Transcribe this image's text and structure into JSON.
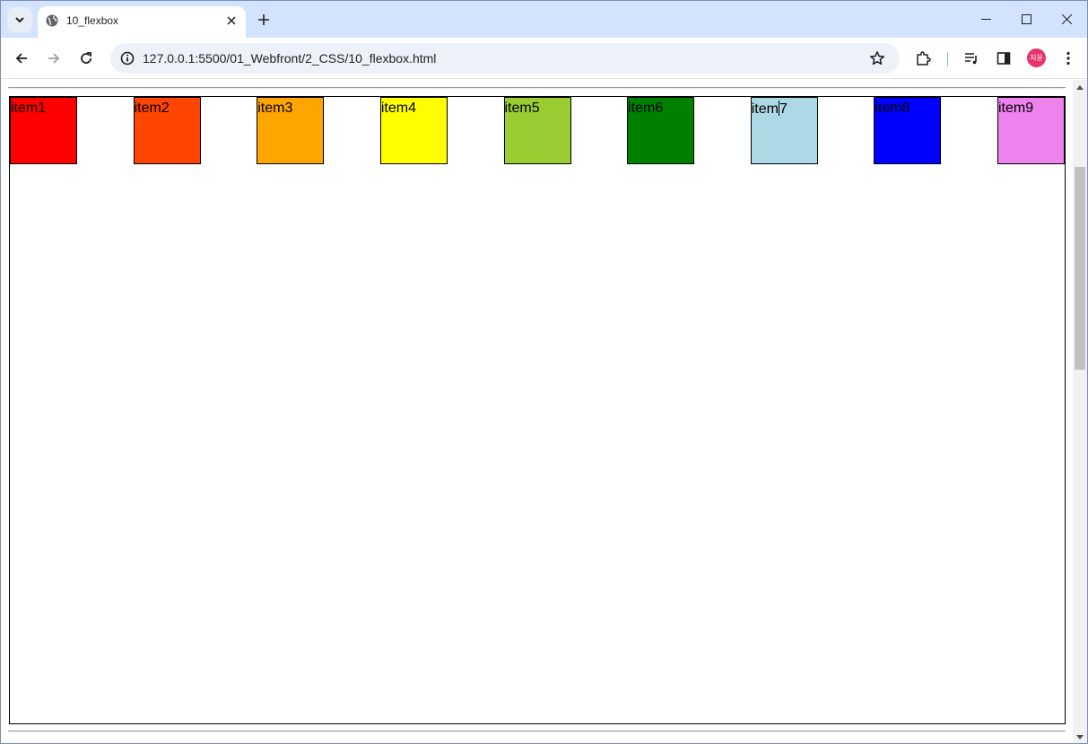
{
  "browser": {
    "tab_title": "10_flexbox",
    "url": "127.0.0.1:5500/01_Webfront/2_CSS/10_flexbox.html",
    "profile_initials": "지윤",
    "accent": "#d3e3fd",
    "profile_color": "#e8336d"
  },
  "page": {
    "items": [
      {
        "label": "item1",
        "color": "red"
      },
      {
        "label": "item2",
        "color": "orangered"
      },
      {
        "label": "item3",
        "color": "orange"
      },
      {
        "label": "item4",
        "color": "yellow"
      },
      {
        "label": "item5",
        "color": "yellowgreen"
      },
      {
        "label": "item6",
        "color": "green"
      },
      {
        "label": "item7",
        "color": "lightblue"
      },
      {
        "label": "item8",
        "color": "blue"
      },
      {
        "label": "item9",
        "color": "violet"
      }
    ]
  },
  "icons": {
    "tab_search": "chevron-down-icon",
    "favicon": "globe-icon",
    "tab_close": "close-icon",
    "new_tab": "plus-icon",
    "minimize": "minimize-icon",
    "maximize": "maximize-icon",
    "close_window": "close-icon",
    "back": "back-arrow-icon",
    "forward": "forward-arrow-icon",
    "reload": "reload-icon",
    "site_info": "info-icon",
    "bookmark": "star-icon",
    "extensions": "puzzle-icon",
    "media": "media-queue-icon",
    "side_panel": "side-panel-icon",
    "menu": "kebab-menu-icon"
  }
}
